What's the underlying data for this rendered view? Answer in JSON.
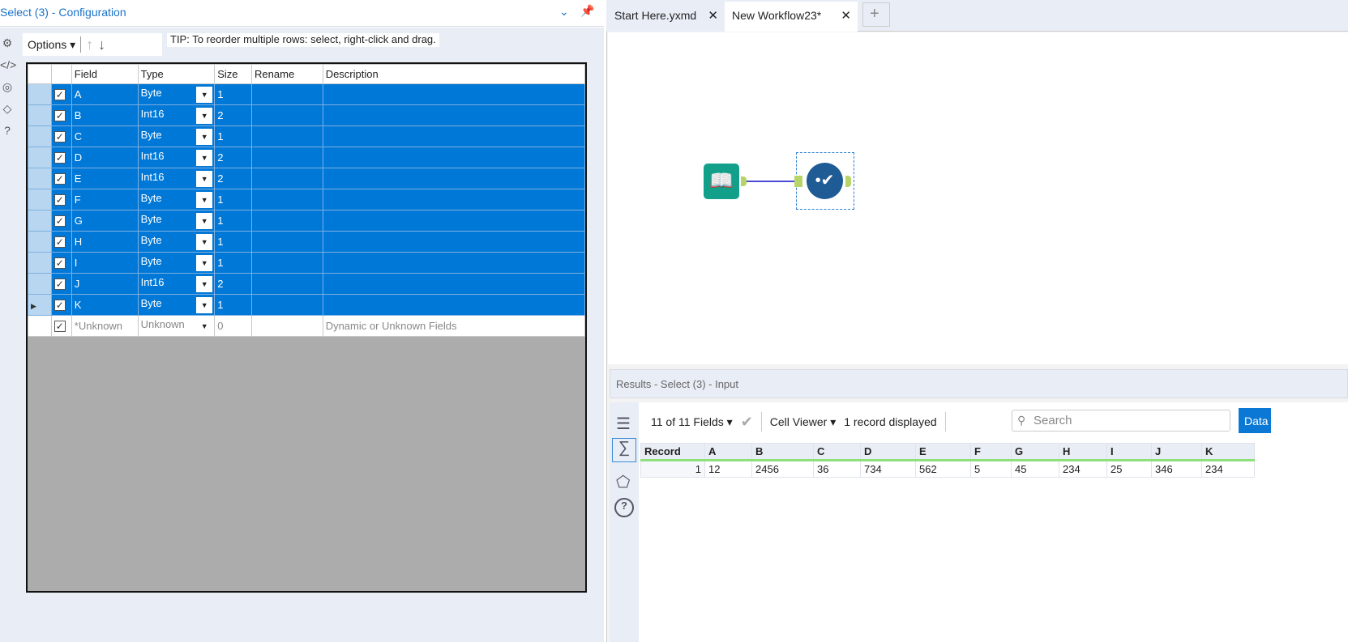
{
  "config": {
    "title": "Select (3) - Configuration",
    "options_label": "Options",
    "tip": "TIP: To reorder multiple rows: select, right-click and drag.",
    "columns": [
      "Field",
      "Type",
      "Size",
      "Rename",
      "Description"
    ],
    "rows": [
      {
        "field": "A",
        "type": "Byte",
        "size": "1",
        "rename": "",
        "description": "",
        "selected": true
      },
      {
        "field": "B",
        "type": "Int16",
        "size": "2",
        "rename": "",
        "description": "",
        "selected": true
      },
      {
        "field": "C",
        "type": "Byte",
        "size": "1",
        "rename": "",
        "description": "",
        "selected": true
      },
      {
        "field": "D",
        "type": "Int16",
        "size": "2",
        "rename": "",
        "description": "",
        "selected": true
      },
      {
        "field": "E",
        "type": "Int16",
        "size": "2",
        "rename": "",
        "description": "",
        "selected": true
      },
      {
        "field": "F",
        "type": "Byte",
        "size": "1",
        "rename": "",
        "description": "",
        "selected": true
      },
      {
        "field": "G",
        "type": "Byte",
        "size": "1",
        "rename": "",
        "description": "",
        "selected": true
      },
      {
        "field": "H",
        "type": "Byte",
        "size": "1",
        "rename": "",
        "description": "",
        "selected": true
      },
      {
        "field": "I",
        "type": "Byte",
        "size": "1",
        "rename": "",
        "description": "",
        "selected": true
      },
      {
        "field": "J",
        "type": "Int16",
        "size": "2",
        "rename": "",
        "description": "",
        "selected": true
      },
      {
        "field": "K",
        "type": "Byte",
        "size": "1",
        "rename": "",
        "description": "",
        "selected": true
      },
      {
        "field": "*Unknown",
        "type": "Unknown",
        "size": "0",
        "rename": "",
        "description": "Dynamic or Unknown Fields",
        "selected": false
      }
    ]
  },
  "tabs": [
    {
      "label": "Start Here.yxmd"
    },
    {
      "label": "New Workflow23*"
    }
  ],
  "results": {
    "title": "Results - Select (3) - Input",
    "fields_label": "11 of 11 Fields",
    "viewer_label": "Cell Viewer",
    "records_label": "1 record displayed",
    "search_placeholder": "Search",
    "data_button": "Data",
    "columns": [
      "Record",
      "A",
      "B",
      "C",
      "D",
      "E",
      "F",
      "G",
      "H",
      "I",
      "J",
      "K"
    ],
    "rows": [
      [
        "1",
        "12",
        "2456",
        "36",
        "734",
        "562",
        "5",
        "45",
        "234",
        "25",
        "346",
        "234"
      ]
    ]
  },
  "colors": {
    "accent": "#0078d7",
    "selection": "#0078d7"
  }
}
